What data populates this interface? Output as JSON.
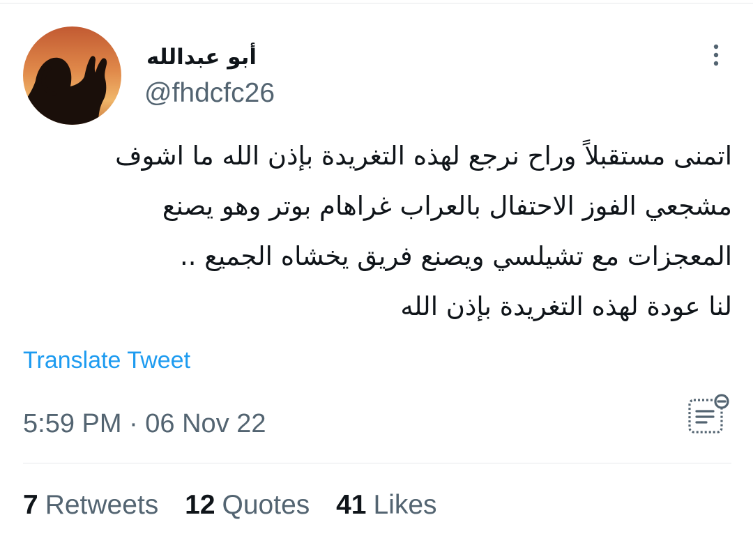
{
  "author": {
    "display_name": "أبو عبدالله",
    "handle": "@fhdcfc26",
    "avatar_icon": "person-praying-silhouette-sunset"
  },
  "tweet": {
    "lines": [
      "اتمنى مستقبلاً وراح نرجع لهذه التغريدة بإذن الله ما اشوف",
      "مشجعي الفوز الاحتفال بالعراب غراهام بوتر وهو يصنع",
      "المعجزات مع تشيلسي ويصنع فريق يخشاه الجميع ..",
      "لنا عودة لهذه التغريدة بإذن الله"
    ],
    "translate_label": "Translate Tweet",
    "timestamp": "5:59 PM · 06 Nov 22"
  },
  "stats": {
    "retweets_count": "7",
    "retweets_label": "Retweets",
    "quotes_count": "12",
    "quotes_label": "Quotes",
    "likes_count": "41",
    "likes_label": "Likes"
  },
  "icons": {
    "more": "vertical-dots-icon",
    "notes": "notes-minus-icon"
  },
  "colors": {
    "link": "#1d9bf0",
    "secondary_text": "#536471",
    "primary_text": "#0f1419",
    "icon_gray": "#536471"
  }
}
